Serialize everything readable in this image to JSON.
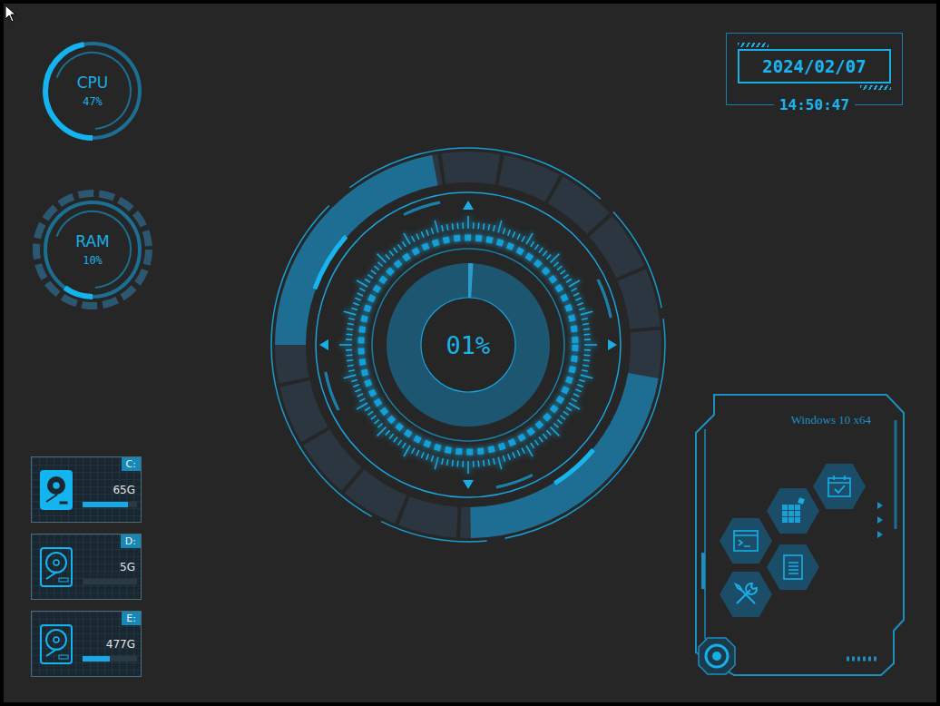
{
  "gauges": [
    {
      "label": "CPU",
      "reading": "47%",
      "level": 0.47,
      "kind": "plain"
    },
    {
      "label": "RAM",
      "reading": "10%",
      "level": 0.1,
      "kind": "segmented"
    }
  ],
  "disks": [
    {
      "letter": "C:",
      "size": "65G",
      "level": 0.83,
      "active": true
    },
    {
      "letter": "D:",
      "size": "5G",
      "level": 0.0,
      "active": false
    },
    {
      "letter": "E:",
      "size": "477G",
      "level": 0.5,
      "active": false
    }
  ],
  "core": {
    "reading": "01%",
    "level": 0.01
  },
  "clock": {
    "date": "2024/02/07",
    "time": "14:50:47"
  },
  "launcher": {
    "os": "Windows 10 x64"
  }
}
